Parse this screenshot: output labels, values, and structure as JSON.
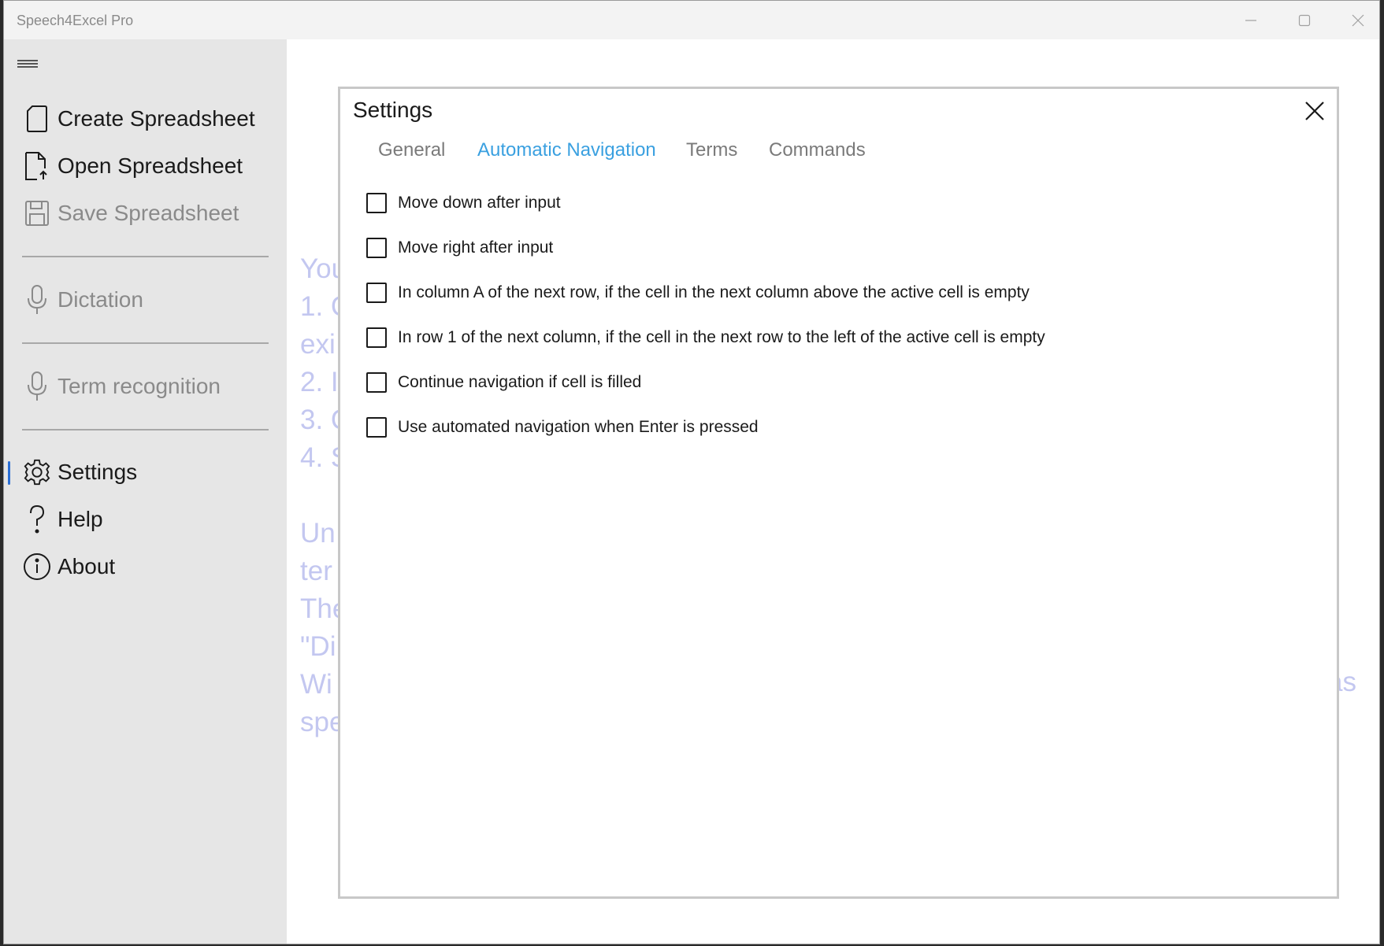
{
  "window": {
    "title": "Speech4Excel Pro",
    "controls": {
      "minimize": "minimize-icon",
      "maximize": "maximize-icon",
      "close": "close-icon"
    }
  },
  "sidebar": {
    "menu_icon": "hamburger-icon",
    "items": [
      {
        "label": "Create Spreadsheet",
        "icon": "document-icon",
        "enabled": true,
        "selected": false
      },
      {
        "label": "Open Spreadsheet",
        "icon": "document-open-icon",
        "enabled": true,
        "selected": false
      },
      {
        "label": "Save Spreadsheet",
        "icon": "save-icon",
        "enabled": false,
        "selected": false
      },
      {
        "label": "Dictation",
        "icon": "microphone-icon",
        "enabled": false,
        "selected": false
      },
      {
        "label": "Term recognition",
        "icon": "microphone-icon",
        "enabled": false,
        "selected": false
      },
      {
        "label": "Settings",
        "icon": "gear-icon",
        "enabled": true,
        "selected": true
      },
      {
        "label": "Help",
        "icon": "question-icon",
        "enabled": true,
        "selected": false
      },
      {
        "label": "About",
        "icon": "info-icon",
        "enabled": true,
        "selected": false
      }
    ]
  },
  "background_text": {
    "lines": [
      "You",
      "1. C",
      "exi",
      "2. I",
      "3. C",
      "4. S",
      "",
      "Un",
      "ter",
      "The",
      "\"Di",
      "Wi",
      "spe"
    ],
    "trailing": "as"
  },
  "settings_dialog": {
    "title": "Settings",
    "tabs": [
      {
        "label": "General",
        "active": false
      },
      {
        "label": "Automatic Navigation",
        "active": true
      },
      {
        "label": "Terms",
        "active": false
      },
      {
        "label": "Commands",
        "active": false
      }
    ],
    "options": [
      {
        "label": "Move down after input",
        "checked": false
      },
      {
        "label": "Move right after input",
        "checked": false
      },
      {
        "label": "In column A of the next row, if the cell in the next column above the active cell is empty",
        "checked": false
      },
      {
        "label": "In row 1 of the next column, if the cell in the next row to the left of the active cell is empty",
        "checked": false
      },
      {
        "label": "Continue navigation if cell is filled",
        "checked": false
      },
      {
        "label": "Use automated navigation when Enter is pressed",
        "checked": false
      }
    ]
  },
  "colors": {
    "accent_tab": "#3aa0e0",
    "selection_bar": "#2a6fd6",
    "sidebar_bg": "#e6e6e6",
    "background_text": "#c3c7f0"
  }
}
